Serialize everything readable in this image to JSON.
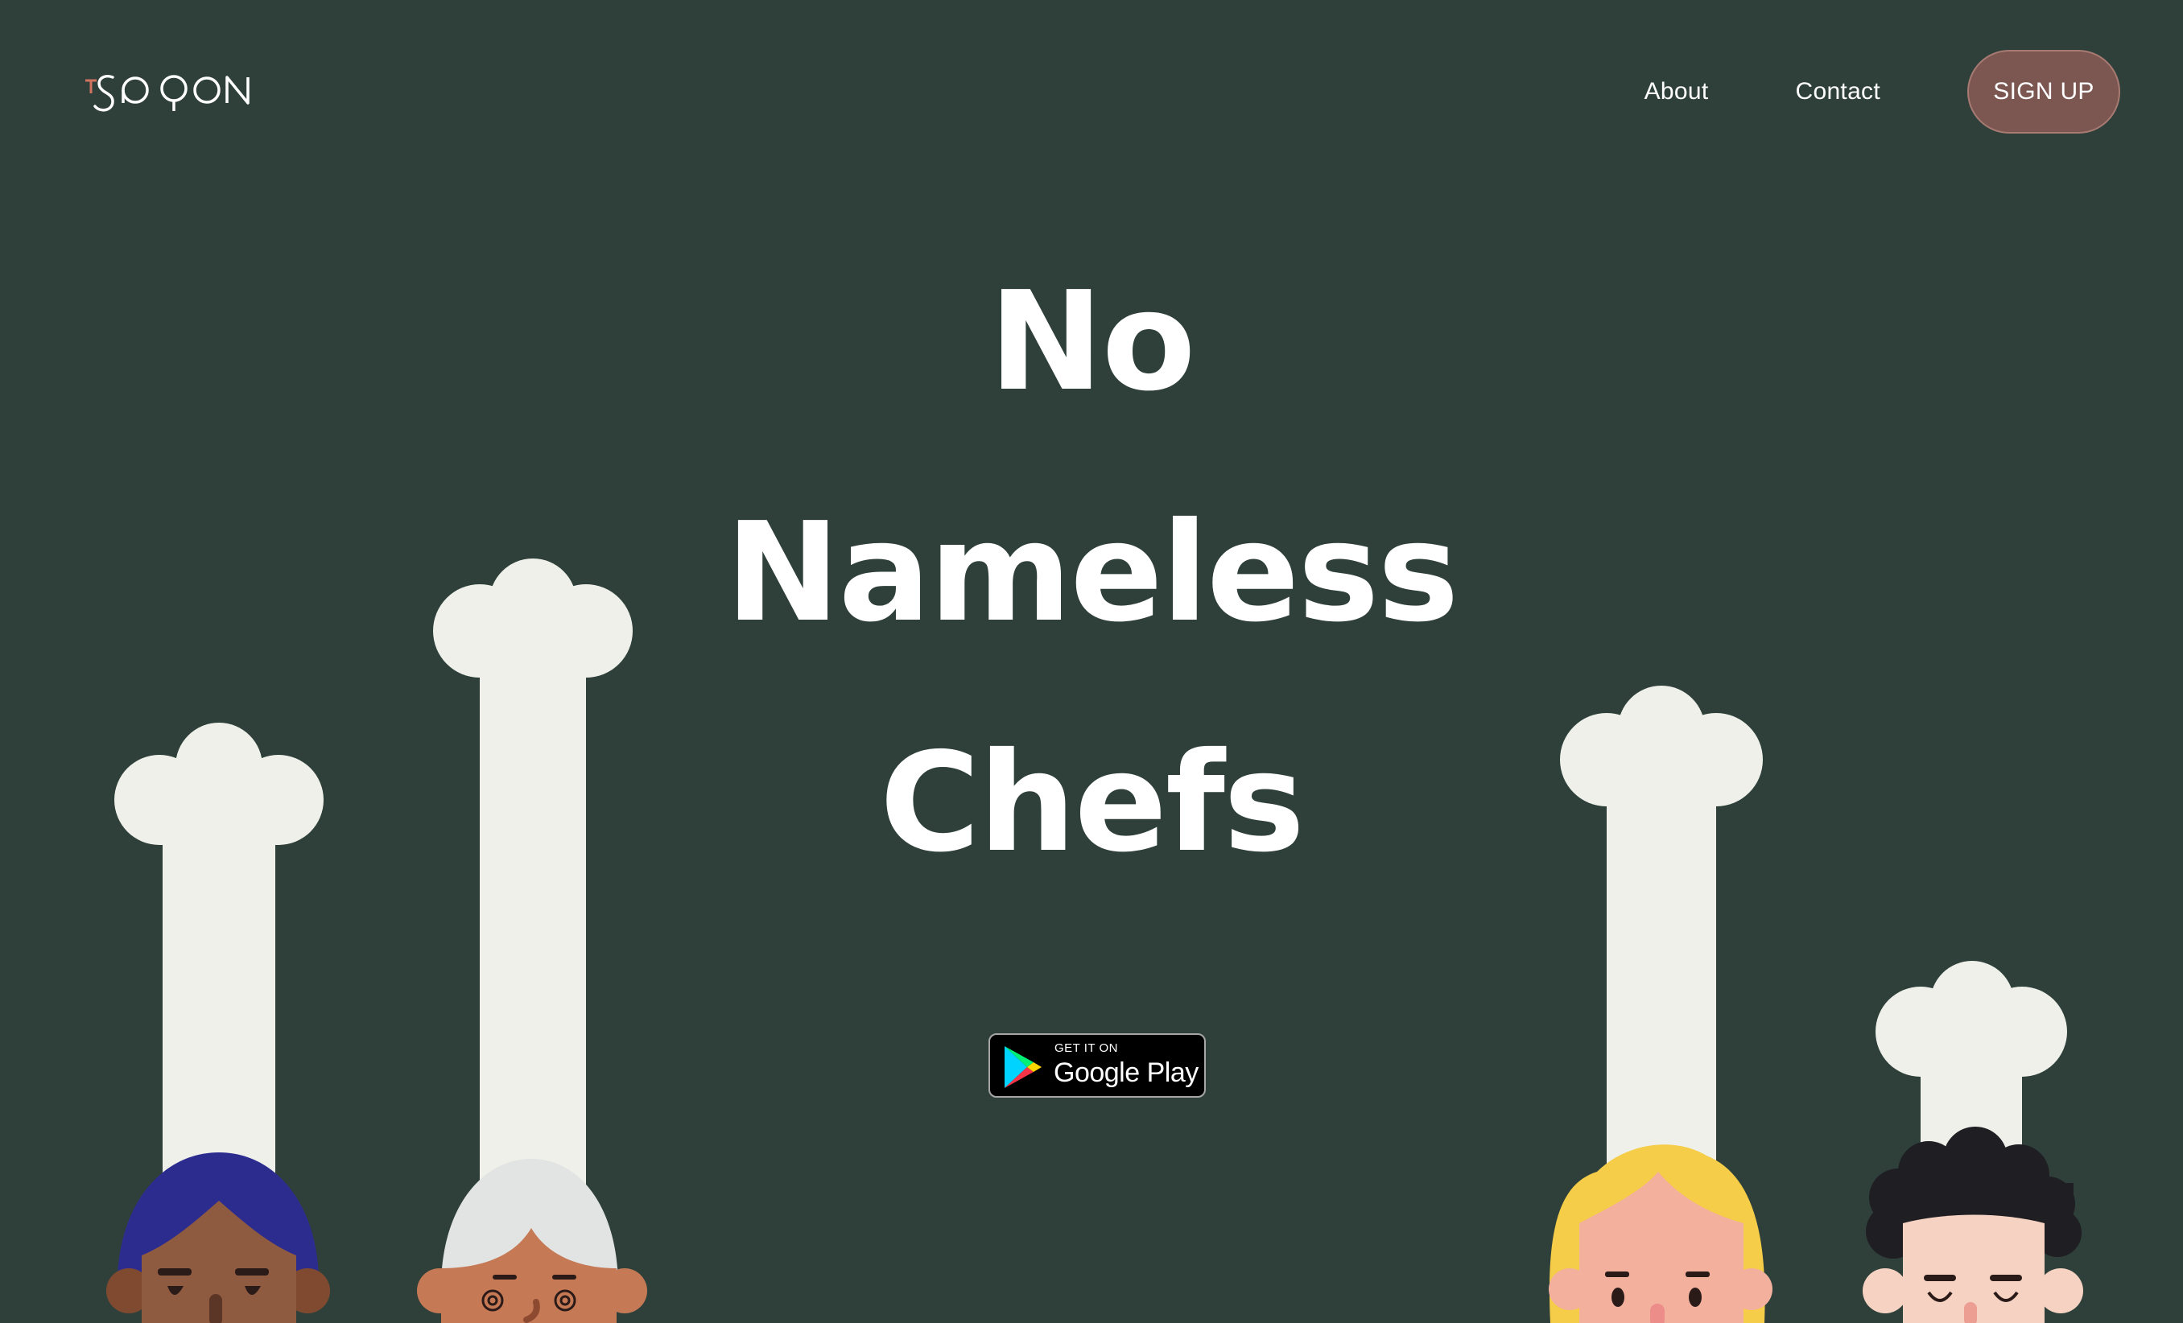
{
  "header": {
    "logo_text": "TSPOON",
    "nav": [
      {
        "label": "About"
      },
      {
        "label": "Contact"
      }
    ],
    "signup_label": "SIGN UP"
  },
  "hero": {
    "line1": "No",
    "line2": "Nameless",
    "line3": "Chefs"
  },
  "store_badge": {
    "small": "GET IT ON",
    "big": "Google Play"
  },
  "colors": {
    "background": "#2f403b",
    "accent_button": "#7c5650",
    "chef_hat": "#eff0ea",
    "logo_t": "#d0735f"
  },
  "illustration": {
    "chefs": [
      "purple-hair-chef",
      "gray-hair-chef",
      "blonde-chef",
      "curly-hair-chef"
    ]
  }
}
